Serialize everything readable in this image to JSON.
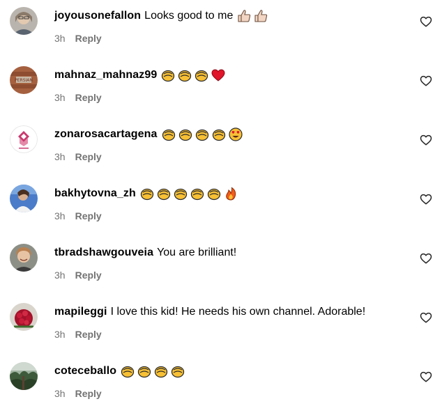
{
  "comments": [
    {
      "username": "joyousonefallon",
      "text": "Looks good to me",
      "emojis": [
        "thumbs-up-light",
        "thumbs-up-light"
      ],
      "time": "3h",
      "reply_label": "Reply",
      "avatar": "avatar-woman-glasses"
    },
    {
      "username": "mahnaz_mahnaz99",
      "text": "",
      "emojis": [
        "clapping-hands",
        "clapping-hands",
        "clapping-hands",
        "red-heart"
      ],
      "time": "3h",
      "reply_label": "Reply",
      "avatar": "avatar-brick-sign"
    },
    {
      "username": "zonarosacartagena",
      "text": "",
      "emojis": [
        "clapping-hands",
        "clapping-hands",
        "clapping-hands",
        "clapping-hands",
        "heart-eyes-face"
      ],
      "time": "3h",
      "reply_label": "Reply",
      "avatar": "avatar-pink-logo"
    },
    {
      "username": "bakhytovna_zh",
      "text": "",
      "emojis": [
        "clapping-hands",
        "clapping-hands",
        "clapping-hands",
        "clapping-hands",
        "clapping-hands",
        "fire"
      ],
      "time": "3h",
      "reply_label": "Reply",
      "avatar": "avatar-woman-blue"
    },
    {
      "username": "tbradshawgouveia",
      "text": "You are brilliant!",
      "emojis": [],
      "time": "3h",
      "reply_label": "Reply",
      "avatar": "avatar-woman-smiling"
    },
    {
      "username": "mapileggi",
      "text": "I love this kid! He needs his own channel. Adorable!",
      "emojis": [],
      "time": "3h",
      "reply_label": "Reply",
      "avatar": "avatar-red-flowers"
    },
    {
      "username": "coteceballo",
      "text": "",
      "emojis": [
        "clapping-hands",
        "clapping-hands",
        "clapping-hands",
        "clapping-hands"
      ],
      "time": "3h",
      "reply_label": "Reply",
      "avatar": "avatar-forest"
    }
  ],
  "icons": {
    "like": "heart-outline-icon"
  },
  "colors": {
    "meta_text": "#737373",
    "text": "#000000",
    "clap_fill": "#f7c035",
    "heart_red": "#e0142a"
  }
}
